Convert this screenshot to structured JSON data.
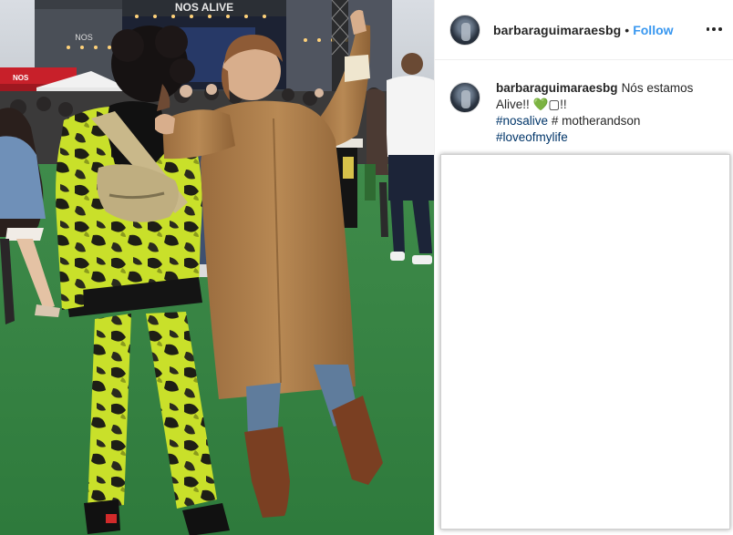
{
  "post": {
    "username": "barbaraguimaraesbg",
    "separator": "•",
    "follow_label": "Follow",
    "more_icon": "more-options-icon",
    "caption": {
      "username": "barbaraguimaraesbg",
      "line1": "Nós estamos",
      "line2": "Alive!! 💚▢!!",
      "hashtag1": "#nosalive",
      "plain": "# motherandson",
      "hashtag2": "#loveofmylife"
    }
  },
  "photo": {
    "stage_sign": "NOS ALIVE",
    "stage_logo": "NOS",
    "booth_sign": "NOS"
  },
  "colors": {
    "accent": "#3897f0",
    "hashtag": "#003569",
    "text": "#262626",
    "grass": "#2e7a3c",
    "coat": "#a87a4a",
    "camo_yellow": "#c9e02a"
  }
}
